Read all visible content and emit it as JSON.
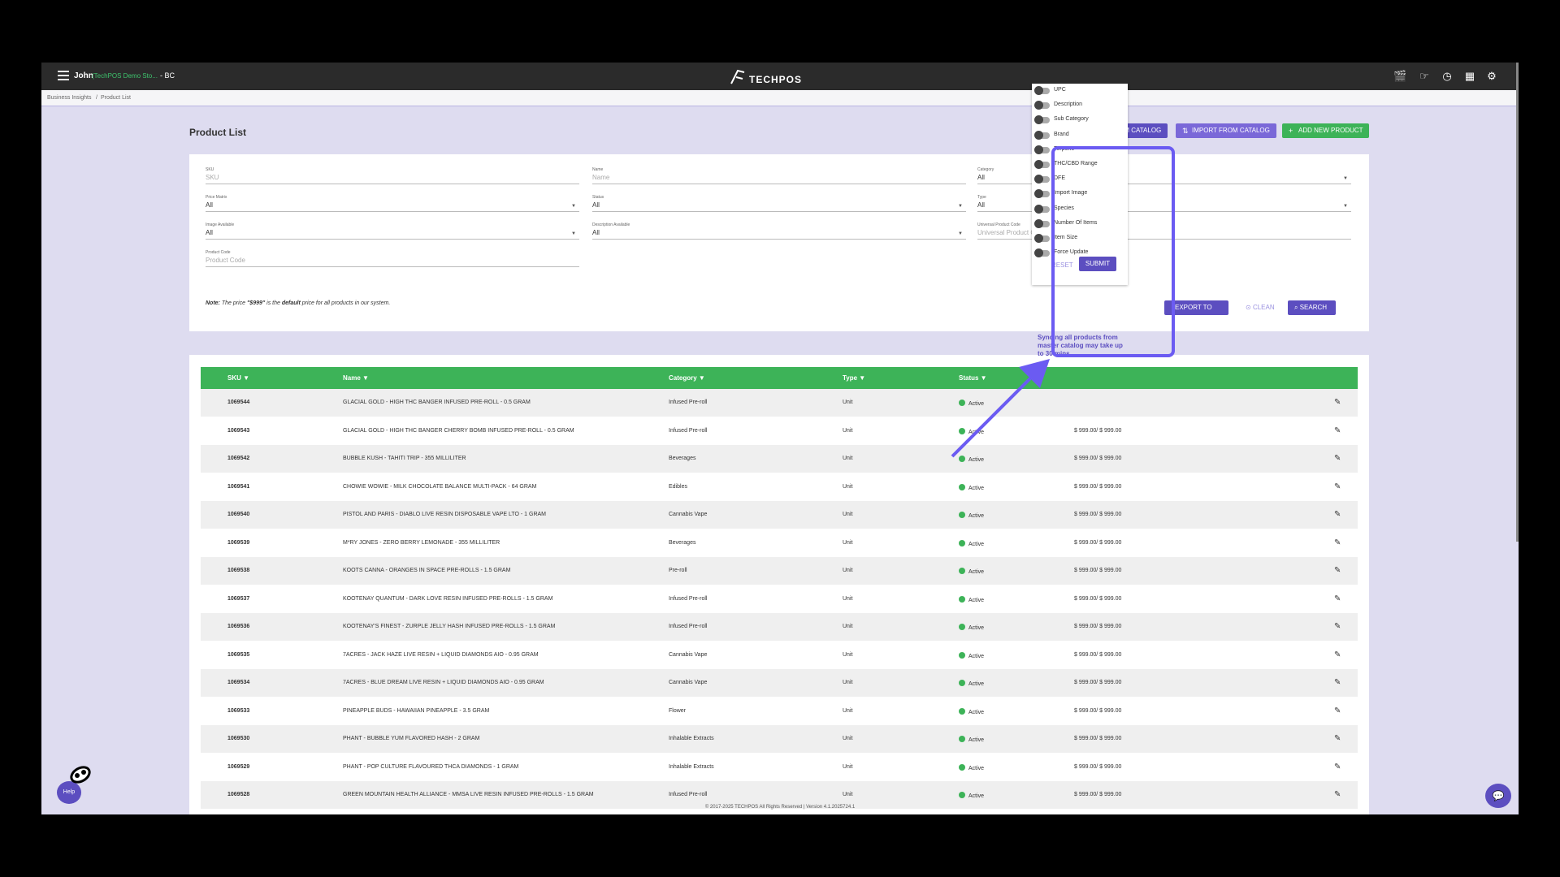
{
  "topbar": {
    "user": "John",
    "store": "(TechPOS Demo Sto...",
    "region": "- BC",
    "logo": "TECHPOS"
  },
  "breadcrumb": {
    "item1": "Business Insights",
    "sep": "/",
    "item2": "Product List"
  },
  "page_title": "Product List",
  "header_buttons": {
    "sync": "SYNC FROM CATALOG",
    "import": "IMPORT FROM CATALOG",
    "add": "ADD NEW PRODUCT"
  },
  "filters": {
    "sku": {
      "label": "SKU",
      "placeholder": "SKU"
    },
    "name": {
      "label": "Name",
      "placeholder": "Name"
    },
    "category": {
      "label": "Category",
      "value": "All"
    },
    "price_matrix": {
      "label": "Price Matrix",
      "value": "All"
    },
    "status": {
      "label": "Status",
      "value": "All"
    },
    "type": {
      "label": "Type",
      "value": "All"
    },
    "image_available": {
      "label": "Image Available",
      "value": "All"
    },
    "description_available": {
      "label": "Description Available",
      "value": "All"
    },
    "upc": {
      "label": "Universal Product Code",
      "placeholder": "Universal Product Code"
    },
    "product_code": {
      "label": "Product Code",
      "placeholder": "Product Code"
    }
  },
  "note": {
    "label": "Note:",
    "pre": "The price",
    "price": "\"$999\"",
    "mid": "is the",
    "default": "default",
    "post": "price for all products in our system."
  },
  "actions": {
    "export": "EXPORT TO .XLSX",
    "clean": "CLEAN",
    "search": "SEARCH"
  },
  "table": {
    "headers": {
      "sku": "SKU ▼",
      "name": "Name ▼",
      "category": "Category ▼",
      "type": "Type ▼",
      "status": "Status ▼"
    },
    "rows": [
      {
        "sku": "1069544",
        "name": "GLACIAL GOLD - HIGH THC BANGER INFUSED PRE-ROLL - 0.5 GRAM",
        "category": "Infused Pre-roll",
        "type": "Unit",
        "status": "Active",
        "price": ""
      },
      {
        "sku": "1069543",
        "name": "GLACIAL GOLD - HIGH THC BANGER CHERRY BOMB INFUSED PRE-ROLL - 0.5 GRAM",
        "category": "Infused Pre-roll",
        "type": "Unit",
        "status": "Active",
        "price": "$ 999.00/ $ 999.00"
      },
      {
        "sku": "1069542",
        "name": "BUBBLE KUSH - TAHITI TRIP - 355 MILLILITER",
        "category": "Beverages",
        "type": "Unit",
        "status": "Active",
        "price": "$ 999.00/ $ 999.00"
      },
      {
        "sku": "1069541",
        "name": "CHOWIE WOWIE - MILK CHOCOLATE BALANCE MULTI-PACK - 64 GRAM",
        "category": "Edibles",
        "type": "Unit",
        "status": "Active",
        "price": "$ 999.00/ $ 999.00"
      },
      {
        "sku": "1069540",
        "name": "PISTOL AND PARIS - DIABLO LIVE RESIN DISPOSABLE VAPE LTO - 1 GRAM",
        "category": "Cannabis Vape",
        "type": "Unit",
        "status": "Active",
        "price": "$ 999.00/ $ 999.00"
      },
      {
        "sku": "1069539",
        "name": "M*RY JONES - ZERO BERRY LEMONADE - 355 MILLILITER",
        "category": "Beverages",
        "type": "Unit",
        "status": "Active",
        "price": "$ 999.00/ $ 999.00"
      },
      {
        "sku": "1069538",
        "name": "KOOTS CANNA - ORANGES IN SPACE PRE-ROLLS - 1.5 GRAM",
        "category": "Pre-roll",
        "type": "Unit",
        "status": "Active",
        "price": "$ 999.00/ $ 999.00"
      },
      {
        "sku": "1069537",
        "name": "KOOTENAY QUANTUM - DARK LOVE RESIN INFUSED PRE-ROLLS - 1.5 GRAM",
        "category": "Infused Pre-roll",
        "type": "Unit",
        "status": "Active",
        "price": "$ 999.00/ $ 999.00"
      },
      {
        "sku": "1069536",
        "name": "KOOTENAY'S FINEST - ZURPLE JELLY HASH INFUSED PRE-ROLLS - 1.5 GRAM",
        "category": "Infused Pre-roll",
        "type": "Unit",
        "status": "Active",
        "price": "$ 999.00/ $ 999.00"
      },
      {
        "sku": "1069535",
        "name": "7ACRES - JACK HAZE LIVE RESIN + LIQUID DIAMONDS AIO - 0.95 GRAM",
        "category": "Cannabis Vape",
        "type": "Unit",
        "status": "Active",
        "price": "$ 999.00/ $ 999.00"
      },
      {
        "sku": "1069534",
        "name": "7ACRES - BLUE DREAM LIVE RESIN + LIQUID DIAMONDS AIO - 0.95 GRAM",
        "category": "Cannabis Vape",
        "type": "Unit",
        "status": "Active",
        "price": "$ 999.00/ $ 999.00"
      },
      {
        "sku": "1069533",
        "name": "PINEAPPLE BUDS - HAWAIIAN PINEAPPLE - 3.5 GRAM",
        "category": "Flower",
        "type": "Unit",
        "status": "Active",
        "price": "$ 999.00/ $ 999.00"
      },
      {
        "sku": "1069530",
        "name": "PHANT - BUBBLE YUM FLAVORED HASH - 2 GRAM",
        "category": "Inhalable Extracts",
        "type": "Unit",
        "status": "Active",
        "price": "$ 999.00/ $ 999.00"
      },
      {
        "sku": "1069529",
        "name": "PHANT - POP CULTURE FLAVOURED THCA DIAMONDS - 1 GRAM",
        "category": "Inhalable Extracts",
        "type": "Unit",
        "status": "Active",
        "price": "$ 999.00/ $ 999.00"
      },
      {
        "sku": "1069528",
        "name": "GREEN MOUNTAIN HEALTH ALLIANCE - MMSA LIVE RESIN INFUSED PRE-ROLLS - 1.5 GRAM",
        "category": "Infused Pre-roll",
        "type": "Unit",
        "status": "Active",
        "price": "$ 999.00/ $ 999.00"
      }
    ]
  },
  "sync_panel": {
    "options": [
      "UPC",
      "Description",
      "Sub Category",
      "Brand",
      "Terpene",
      "THC/CBD Range",
      "DFE",
      "Import Image",
      "Species",
      "Number Of Items",
      "Item Size",
      "Force Update"
    ],
    "reset": "RESET",
    "submit": "SUBMIT",
    "note": "Syncing all products from master catalog may take up to 30 mins."
  },
  "footer": "© 2017-2025 TECHPOS All Rights Reserved | Version 4.1.2025724.1",
  "help": "Help",
  "colors": {
    "accent": "#5c4ec0",
    "green": "#3db358",
    "highlight": "#6b5bf2"
  }
}
